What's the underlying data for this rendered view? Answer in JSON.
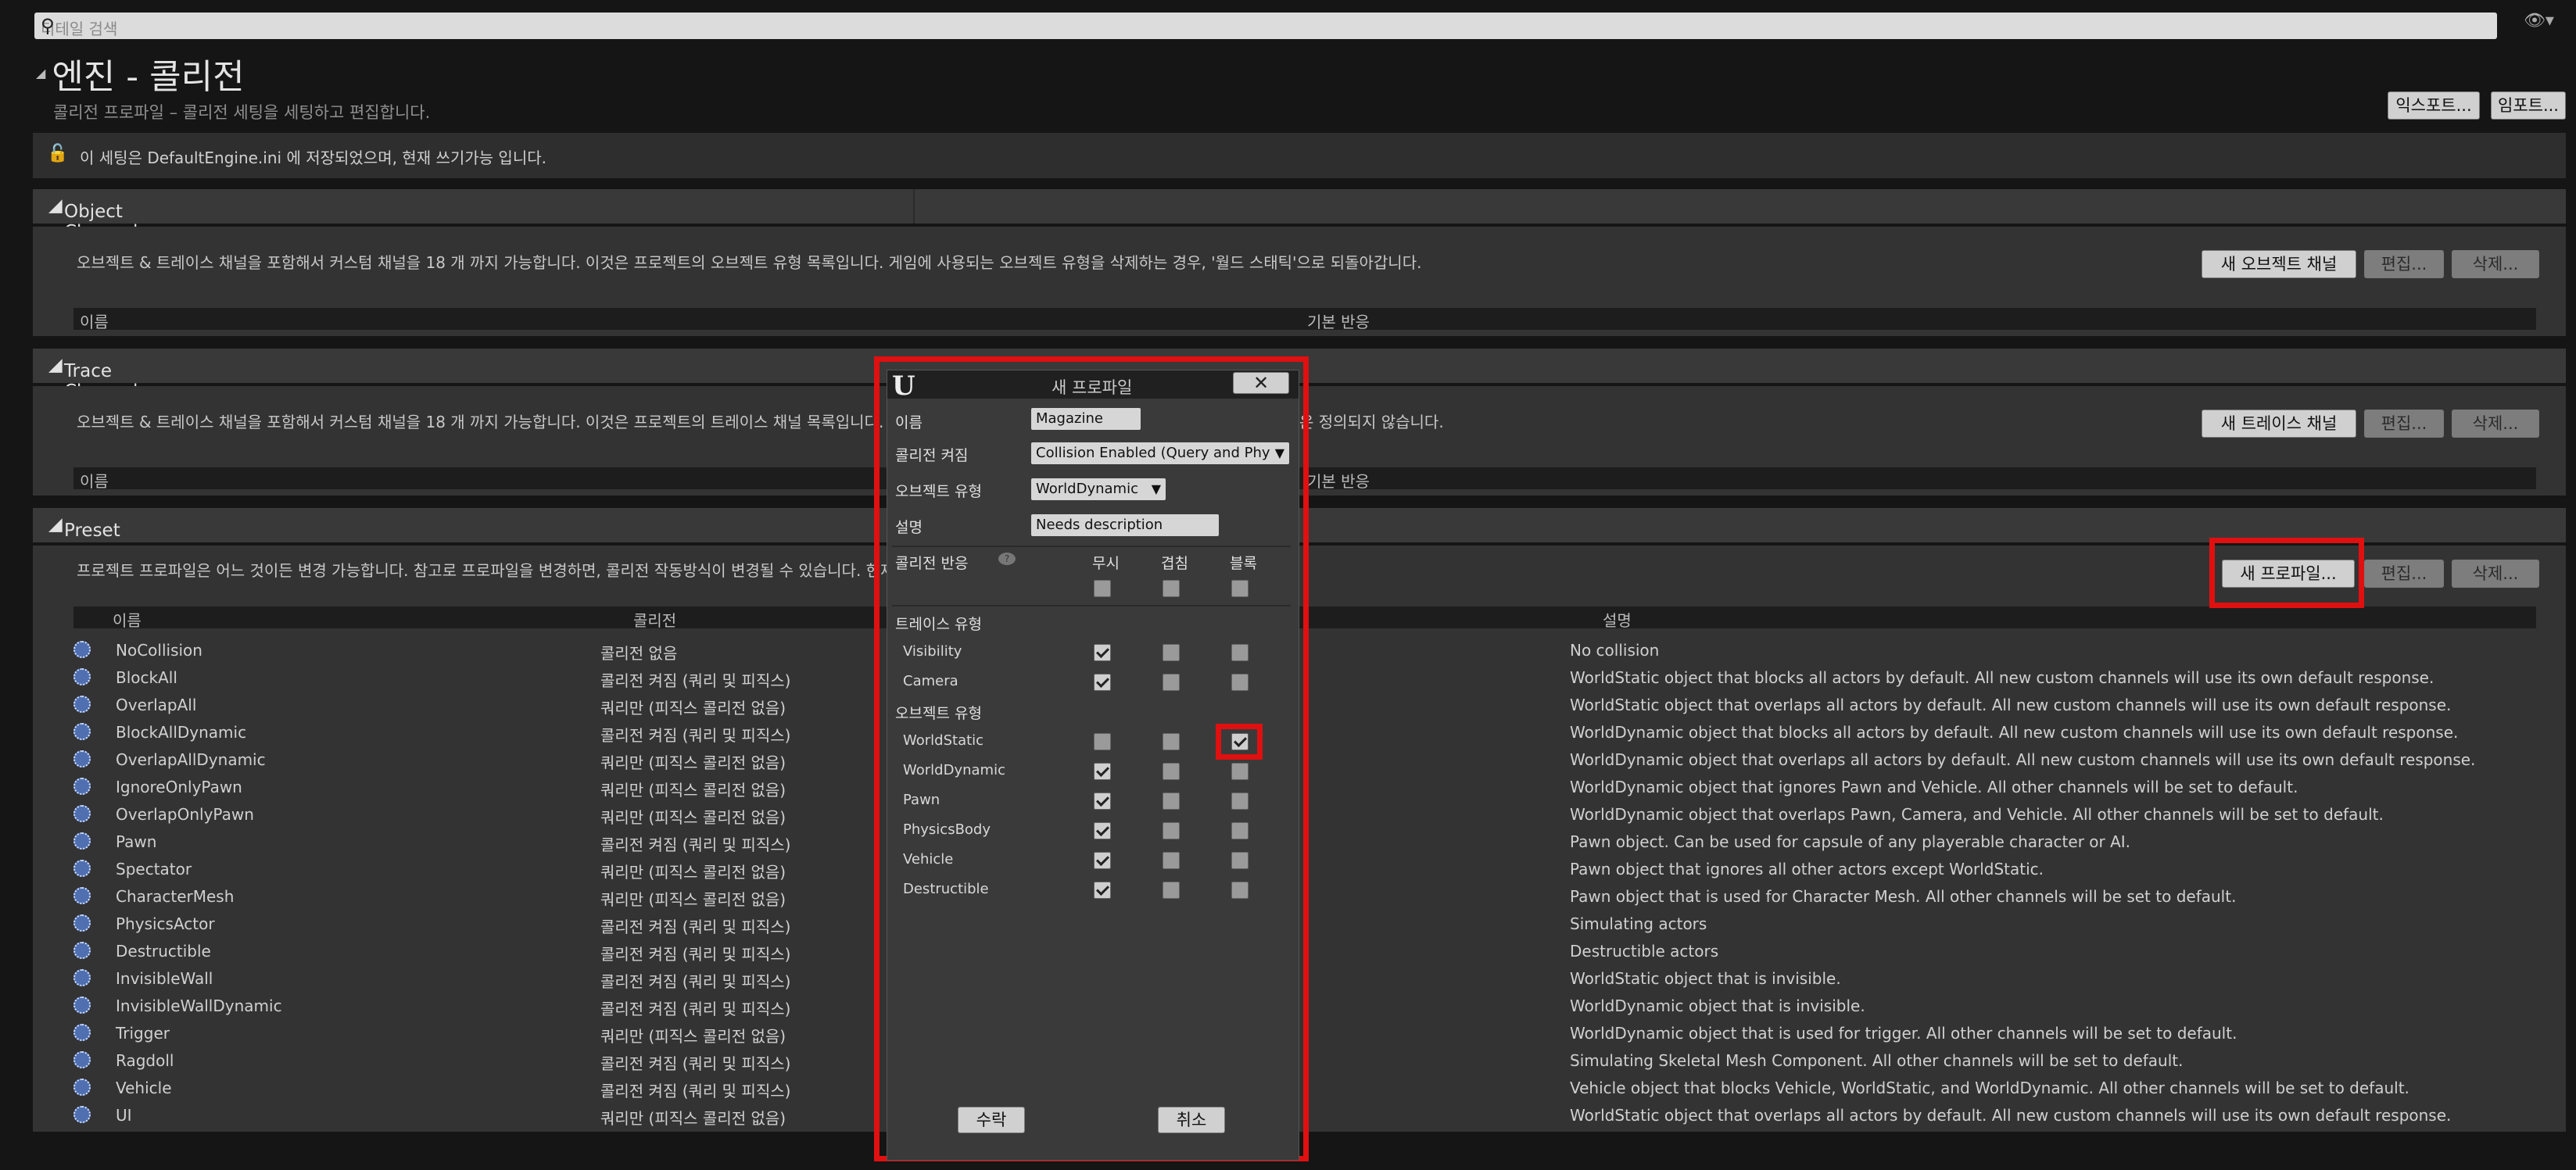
{
  "search": {
    "placeholder": "디테일 검색"
  },
  "icons": {
    "search": "magnifier-icon",
    "eye": "eye-icon",
    "lock": "unlock-icon",
    "preset": "gear-icon"
  },
  "header": {
    "title": "엔진 - 콜리전",
    "subtitle": "콜리전 프로파일 – 콜리전 세팅을 세팅하고 편집합니다.",
    "export_label": "익스포트...",
    "import_label": "임포트...",
    "info": "이 세팅은 DefaultEngine.ini 에 저장되었으며, 현재 쓰기가능 입니다."
  },
  "object_channels": {
    "title": "Object Channels",
    "description": "오브젝트 & 트레이스 채널을 포함해서 커스텀 채널을 18 개 까지 가능합니다. 이것은 프로젝트의 오브젝트 유형 목록입니다. 게임에 사용되는 오브젝트 유형을 삭제하는 경우, '월드 스태틱'으로 되돌아갑니다.",
    "new_label": "새 오브젝트 채널",
    "edit_label": "편집...",
    "delete_label": "삭제...",
    "col_name": "이름",
    "col_default": "기본 반응"
  },
  "trace_channels": {
    "title": "Trace Channels",
    "description": "오브젝트 & 트레이스 채널을 포함해서 커스텀 채널을 18 개 까지 가능합니다. 이것은 프로젝트의 트레이스 채널 목록입니다.",
    "description_tail": "은 정의되지 않습니다.",
    "new_label": "새 트레이스 채널",
    "edit_label": "편집...",
    "delete_label": "삭제...",
    "col_name": "이름",
    "col_default": "기본 반응"
  },
  "preset": {
    "title": "Preset",
    "description": "프로젝트 프로파일은 어느 것이든 변경 가능합니다. 참고로 프로파일을 변경하면, 콜리전 작동방식이 변경될 수 있습니다. 현재 콘",
    "new_label": "새 프로파일...",
    "edit_label": "편집...",
    "delete_label": "삭제...",
    "col_name": "이름",
    "col_collision": "콜리전",
    "col_desc": "설명",
    "rows": [
      {
        "name": "NoCollision",
        "collision": "콜리전 없음",
        "desc": "No collision"
      },
      {
        "name": "BlockAll",
        "collision": "콜리전 켜짐 (쿼리 및 피직스)",
        "desc": "WorldStatic object that blocks all actors by default. All new custom channels will use its own default response."
      },
      {
        "name": "OverlapAll",
        "collision": "쿼리만 (피직스 콜리전 없음)",
        "desc": "WorldStatic object that overlaps all actors by default. All new custom channels will use its own default response."
      },
      {
        "name": "BlockAllDynamic",
        "collision": "콜리전 켜짐 (쿼리 및 피직스)",
        "desc": "WorldDynamic object that blocks all actors by default. All new custom channels will use its own default response."
      },
      {
        "name": "OverlapAllDynamic",
        "collision": "쿼리만 (피직스 콜리전 없음)",
        "desc": "WorldDynamic object that overlaps all actors by default. All new custom channels will use its own default response."
      },
      {
        "name": "IgnoreOnlyPawn",
        "collision": "쿼리만 (피직스 콜리전 없음)",
        "desc": "WorldDynamic object that ignores Pawn and Vehicle. All other channels will be set to default."
      },
      {
        "name": "OverlapOnlyPawn",
        "collision": "쿼리만 (피직스 콜리전 없음)",
        "desc": "WorldDynamic object that overlaps Pawn, Camera, and Vehicle. All other channels will be set to default."
      },
      {
        "name": "Pawn",
        "collision": "콜리전 켜짐 (쿼리 및 피직스)",
        "desc": "Pawn object. Can be used for capsule of any playerable character or AI."
      },
      {
        "name": "Spectator",
        "collision": "쿼리만 (피직스 콜리전 없음)",
        "desc": "Pawn object that ignores all other actors except WorldStatic."
      },
      {
        "name": "CharacterMesh",
        "collision": "쿼리만 (피직스 콜리전 없음)",
        "desc": "Pawn object that is used for Character Mesh. All other channels will be set to default."
      },
      {
        "name": "PhysicsActor",
        "collision": "콜리전 켜짐 (쿼리 및 피직스)",
        "desc": "Simulating actors"
      },
      {
        "name": "Destructible",
        "collision": "콜리전 켜짐 (쿼리 및 피직스)",
        "desc": "Destructible actors"
      },
      {
        "name": "InvisibleWall",
        "collision": "콜리전 켜짐 (쿼리 및 피직스)",
        "desc": "WorldStatic object that is invisible."
      },
      {
        "name": "InvisibleWallDynamic",
        "collision": "콜리전 켜짐 (쿼리 및 피직스)",
        "desc": "WorldDynamic object that is invisible."
      },
      {
        "name": "Trigger",
        "collision": "쿼리만 (피직스 콜리전 없음)",
        "desc": "WorldDynamic object that is used for trigger. All other channels will be set to default."
      },
      {
        "name": "Ragdoll",
        "collision": "콜리전 켜짐 (쿼리 및 피직스)",
        "desc": "Simulating Skeletal Mesh Component. All other channels will be set to default."
      },
      {
        "name": "Vehicle",
        "collision": "콜리전 켜짐 (쿼리 및 피직스)",
        "desc": "Vehicle object that blocks Vehicle, WorldStatic, and WorldDynamic. All other channels will be set to default."
      },
      {
        "name": "UI",
        "collision": "쿼리만 (피직스 콜리전 없음)",
        "desc": "WorldStatic object that overlaps all actors by default. All new custom channels will use its own default response."
      }
    ]
  },
  "dialog": {
    "logo": "U",
    "title": "새 프로파일",
    "close_label": "✕",
    "name_label": "이름",
    "name_value": "Magazine",
    "collision_label": "콜리전 켜짐",
    "collision_value": "Collision Enabled (Query and Phy",
    "object_type_label": "오브젝트 유형",
    "object_type_value": "WorldDynamic",
    "desc_label": "설명",
    "desc_value": "Needs description",
    "response_label": "콜리전 반응",
    "help_icon": "?",
    "col_ignore": "무시",
    "col_overlap": "겹침",
    "col_block": "블록",
    "trace_header": "트레이스 유형",
    "object_header": "오브젝트 유형",
    "all_row": [
      "ignore",
      "unchecked",
      "unchecked",
      "unchecked"
    ],
    "trace_channels": [
      {
        "name": "Visibility",
        "response": "ignore"
      },
      {
        "name": "Camera",
        "response": "ignore"
      }
    ],
    "object_types": [
      {
        "name": "WorldStatic",
        "response": "block"
      },
      {
        "name": "WorldDynamic",
        "response": "ignore"
      },
      {
        "name": "Pawn",
        "response": "ignore"
      },
      {
        "name": "PhysicsBody",
        "response": "ignore"
      },
      {
        "name": "Vehicle",
        "response": "ignore"
      },
      {
        "name": "Destructible",
        "response": "ignore"
      }
    ],
    "accept_label": "수락",
    "cancel_label": "취소"
  }
}
